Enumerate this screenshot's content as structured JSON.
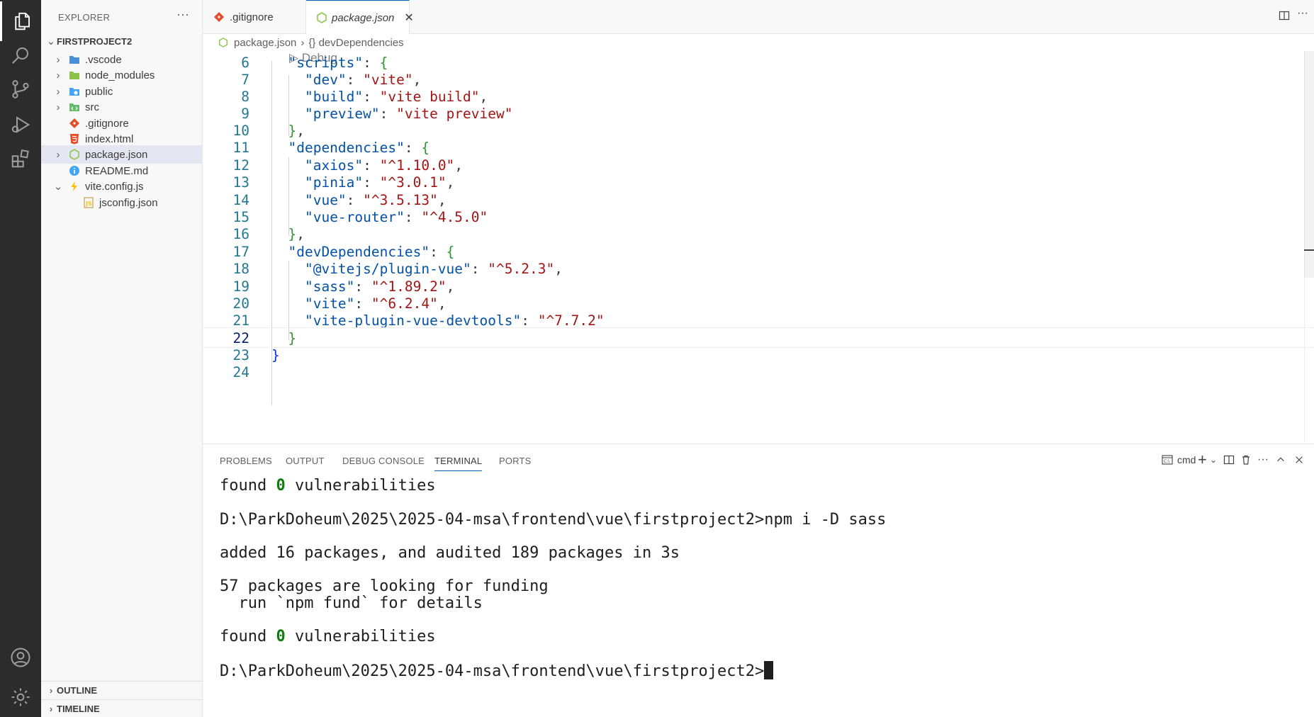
{
  "sidebar": {
    "title": "EXPLORER",
    "root": "FIRSTPROJECT2",
    "items": [
      {
        "label": ".vscode",
        "chev": "›",
        "icon": "folder-vscode-icon",
        "color": "#4a90d9"
      },
      {
        "label": "node_modules",
        "chev": "›",
        "icon": "folder-node-icon",
        "color": "#8bc34a"
      },
      {
        "label": "public",
        "chev": "›",
        "icon": "folder-public-icon",
        "color": "#42a5f5"
      },
      {
        "label": "src",
        "chev": "›",
        "icon": "folder-src-icon",
        "color": "#66bb6a"
      },
      {
        "label": ".gitignore",
        "chev": "",
        "icon": "git-icon",
        "color": "#e44d26"
      },
      {
        "label": "index.html",
        "chev": "",
        "icon": "html-icon",
        "color": "#e44d26"
      },
      {
        "label": "package.json",
        "chev": "›",
        "icon": "nodejs-icon",
        "color": "#8cc84b"
      },
      {
        "label": "README.md",
        "chev": "",
        "icon": "info-icon",
        "color": "#42a5f5"
      },
      {
        "label": "vite.config.js",
        "chev": "⌄",
        "icon": "vite-icon",
        "color": "#ffc107"
      },
      {
        "label": "jsconfig.json",
        "chev": "",
        "icon": "jsconfig-icon",
        "color": "#f5c518"
      }
    ],
    "outline": "OUTLINE",
    "timeline": "TIMELINE"
  },
  "tabs": [
    {
      "label": ".gitignore",
      "active": false
    },
    {
      "label": "package.json",
      "active": true,
      "close": "✕"
    }
  ],
  "breadcrumb": {
    "file": "package.json",
    "sep": "›",
    "symbol": "{} devDependencies"
  },
  "editor": {
    "codelens": "▷ Debug",
    "lines": [
      {
        "n": "6"
      },
      {
        "n": "7"
      },
      {
        "n": "8"
      },
      {
        "n": "9"
      },
      {
        "n": "10"
      },
      {
        "n": "11"
      },
      {
        "n": "12"
      },
      {
        "n": "13"
      },
      {
        "n": "14"
      },
      {
        "n": "15"
      },
      {
        "n": "16"
      },
      {
        "n": "17"
      },
      {
        "n": "18"
      },
      {
        "n": "19"
      },
      {
        "n": "20"
      },
      {
        "n": "21"
      },
      {
        "n": "22"
      },
      {
        "n": "23"
      },
      {
        "n": "24"
      }
    ],
    "code": {
      "scripts_key": "\"scripts\"",
      "dev_key": "\"dev\"",
      "dev_val": "\"vite\"",
      "build_key": "\"build\"",
      "build_val": "\"vite build\"",
      "preview_key": "\"preview\"",
      "preview_val": "\"vite preview\"",
      "deps_key": "\"dependencies\"",
      "axios_key": "\"axios\"",
      "axios_val": "\"^1.10.0\"",
      "pinia_key": "\"pinia\"",
      "pinia_val": "\"^3.0.1\"",
      "vue_key": "\"vue\"",
      "vue_val": "\"^3.5.13\"",
      "router_key": "\"vue-router\"",
      "router_val": "\"^4.5.0\"",
      "devdeps_key": "\"devDependencies\"",
      "plugin_key": "\"@vitejs/plugin-vue\"",
      "plugin_val": "\"^5.2.3\"",
      "sass_key": "\"sass\"",
      "sass_val": "\"^1.89.2\"",
      "vite_key": "\"vite\"",
      "vite_val": "\"^6.2.4\"",
      "devtools_key": "\"vite-plugin-vue-devtools\"",
      "devtools_val": "\"^7.7.2\""
    }
  },
  "panel": {
    "tabs": [
      "PROBLEMS",
      "OUTPUT",
      "DEBUG CONSOLE",
      "TERMINAL",
      "PORTS"
    ],
    "active_tab": "TERMINAL",
    "shell": "cmd",
    "terminal": {
      "found1_a": "found ",
      "zero": "0",
      "found1_b": " vulnerabilities",
      "cmd_line": "D:\\ParkDoheum\\2025\\2025-04-msa\\frontend\\vue\\firstproject2>npm i -D sass",
      "added": "added 16 packages, and audited 189 packages in 3s",
      "funding1": "57 packages are looking for funding",
      "funding2": "  run `npm fund` for details",
      "prompt": "D:\\ParkDoheum\\2025\\2025-04-msa\\frontend\\vue\\firstproject2>"
    }
  },
  "colors": {
    "accent": "#005fb8",
    "activity_bar": "#2c2c2c",
    "string": "#a31515",
    "key": "#0451a5"
  }
}
